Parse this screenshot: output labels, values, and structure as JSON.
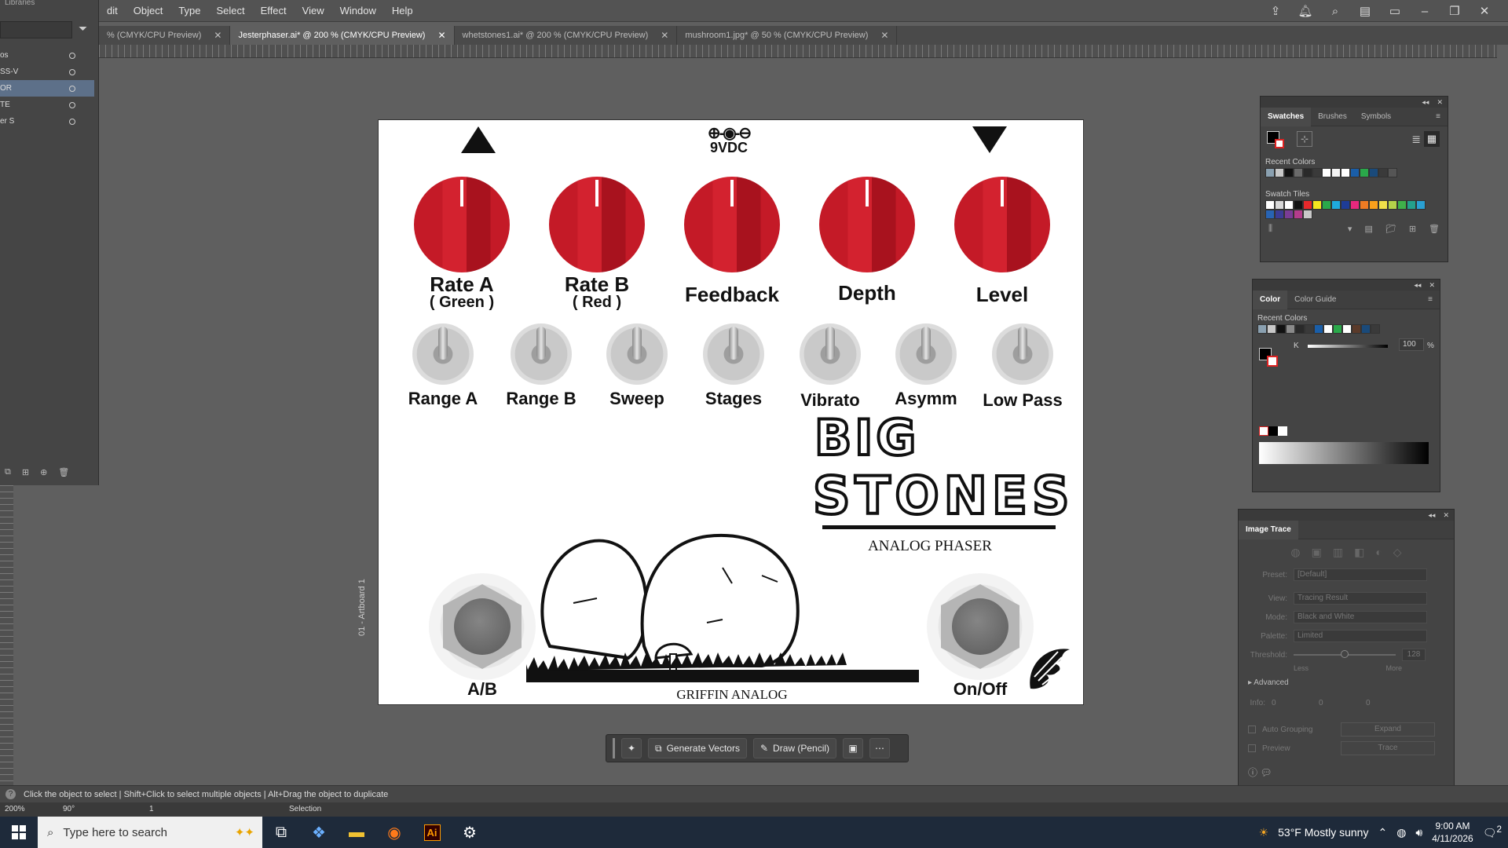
{
  "menu": {
    "items": [
      "dit",
      "Object",
      "Type",
      "Select",
      "Effect",
      "View",
      "Window",
      "Help"
    ]
  },
  "libraries": {
    "title": "Libraries",
    "rows": [
      {
        "label": "os"
      },
      {
        "label": "SS-V"
      },
      {
        "label": "OR"
      },
      {
        "label": "TE"
      },
      {
        "label": "er S"
      }
    ]
  },
  "tabs": [
    {
      "label": "% (CMYK/CPU Preview)"
    },
    {
      "label": "Jesterphaser.ai* @ 200 % (CMYK/CPU Preview)"
    },
    {
      "label": "whetstones1.ai* @ 200 % (CMYK/CPU Preview)"
    },
    {
      "label": "mushroom1.jpg* @ 50 % (CMYK/CPU Preview)"
    }
  ],
  "artboard": {
    "label": "01 - Artboard 1",
    "power": {
      "symbol": "⊕-◉-⊖",
      "label": "9VDC"
    },
    "knobs": [
      {
        "label": "Rate A",
        "sub": "( Green )"
      },
      {
        "label": "Rate B",
        "sub": "( Red )"
      },
      {
        "label": "Feedback",
        "sub": ""
      },
      {
        "label": "Depth",
        "sub": ""
      },
      {
        "label": "Level",
        "sub": ""
      }
    ],
    "toggles": [
      {
        "label": "Range A"
      },
      {
        "label": "Range B"
      },
      {
        "label": "Sweep"
      },
      {
        "label": "Stages"
      },
      {
        "label": "Vibrato"
      },
      {
        "label": "Asymm"
      },
      {
        "label": "Low Pass"
      }
    ],
    "title_line1": "BIG",
    "title_line2": "STONES",
    "subtitle": "ANALOG PHASER",
    "jack_left": "A/B",
    "jack_right": "On/Off",
    "brand": "GRIFFIN ANALOG"
  },
  "context_bar": {
    "generate": "Generate Vectors",
    "draw": "Draw (Pencil)"
  },
  "swatches_panel": {
    "tabs": [
      "Swatches",
      "Brushes",
      "Symbols"
    ],
    "recent": "Recent Colors",
    "tiles": "Swatch Tiles",
    "recent_colors": [
      "#8aa0b0",
      "#c8c8c8",
      "#111111",
      "#6a6a6a",
      "#2a2a2a",
      "#3a3a3a",
      "#ffffff",
      "#f4f4f4",
      "#ffffff",
      "#1a5ea8",
      "#2aa84a",
      "#1a4a7a",
      "#3a3a3a",
      "#555555"
    ],
    "tile_colors": [
      "#ffffff",
      "#d8d8d8",
      "#ffffff",
      "#111111",
      "#e6282b",
      "#f5e61e",
      "#2aa84a",
      "#1eaadc",
      "#1e3c96",
      "#e6287d",
      "#ee7b23",
      "#f9a01b",
      "#f0e04a",
      "#b4d24a",
      "#3fb04a",
      "#24a08c",
      "#2aa0d2",
      "#2864b4",
      "#3c3c96",
      "#7a3c96",
      "#b43c8c",
      "#c8c8c8"
    ]
  },
  "color_panel": {
    "tabs": [
      "Color",
      "Color Guide"
    ],
    "recent": "Recent Colors",
    "k_label": "K",
    "k_value": "100",
    "pct": "%",
    "recent_colors": [
      "#8aa0b0",
      "#c8c8c8",
      "#111111",
      "#8a8a8a",
      "#2a2a2a",
      "#3a3a3a",
      "#1a5ea8",
      "#ffffff",
      "#2aa84a",
      "#ffffff",
      "#5a3a2a",
      "#1a4a7a",
      "#3a3a3a"
    ]
  },
  "image_trace": {
    "title": "Image Trace",
    "preset_label": "Preset:",
    "preset": "[Default]",
    "view_label": "View:",
    "view": "Tracing Result",
    "mode_label": "Mode:",
    "mode": "Black and White",
    "palette_label": "Palette:",
    "palette": "Limited",
    "threshold_label": "Threshold:",
    "threshold": "128",
    "less": "Less",
    "more": "More",
    "advanced": "Advanced",
    "info_label": "Info:",
    "info_a": "0",
    "info_b": "0",
    "info_c": "0",
    "auto_grouping": "Auto Grouping",
    "expand": "Expand",
    "preview": "Preview",
    "trace": "Trace"
  },
  "status": {
    "hint": "Click the object to select  |  Shift+Click to select multiple objects  |  Alt+Drag the object to duplicate",
    "zoom": "200%",
    "rotate": "90°",
    "page": "1",
    "tool": "Selection"
  },
  "taskbar": {
    "search": "Type here to search",
    "weather": "53°F  Mostly sunny",
    "time": "9:00 AM",
    "date": "4/11/2026",
    "notif": "2"
  }
}
